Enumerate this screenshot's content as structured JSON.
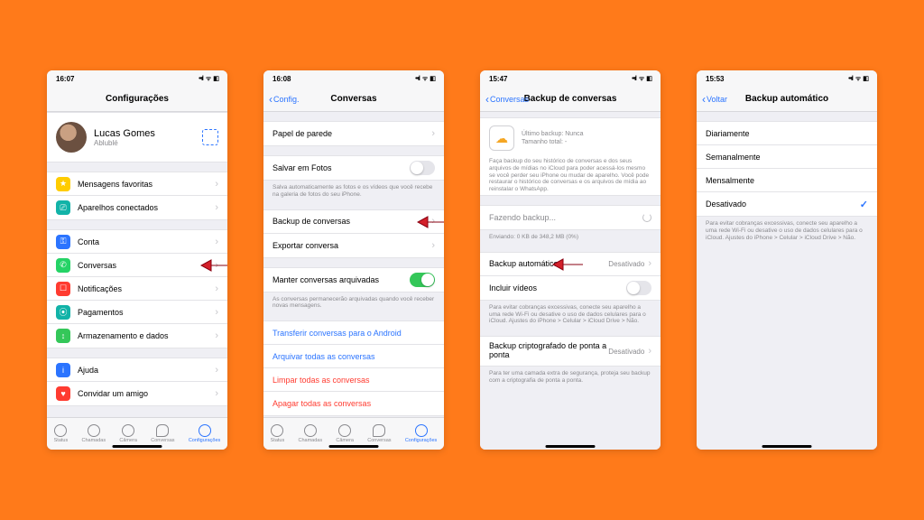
{
  "status": {
    "time1": "16:07",
    "time2": "16:08",
    "time3": "15:47",
    "time4": "15:53"
  },
  "tabs": {
    "status": "Status",
    "calls": "Chamadas",
    "camera": "Câmera",
    "chats": "Conversas",
    "settings": "Configurações"
  },
  "screen1": {
    "title": "Configurações",
    "profile": {
      "name": "Lucas Gomes",
      "status": "Ablublé"
    },
    "starred": "Mensagens favoritas",
    "linked": "Aparelhos conectados",
    "account": "Conta",
    "chats": "Conversas",
    "notif": "Notificações",
    "pay": "Pagamentos",
    "storage": "Armazenamento e dados",
    "help": "Ajuda",
    "invite": "Convidar um amigo"
  },
  "screen2": {
    "back": "Config.",
    "title": "Conversas",
    "wallpaper": "Papel de parede",
    "savePhotos": "Salvar em Fotos",
    "savePhotos_note": "Salva automaticamente as fotos e os vídeos que você recebe na galeria de fotos do seu iPhone.",
    "backup": "Backup de conversas",
    "export": "Exportar conversa",
    "keepArchived": "Manter conversas arquivadas",
    "keepArchived_note": "As conversas permanecerão arquivadas quando você receber novas mensagens.",
    "transfer": "Transferir conversas para o Android",
    "archiveAll": "Arquivar todas as conversas",
    "clearAll": "Limpar todas as conversas",
    "deleteAll": "Apagar todas as conversas"
  },
  "screen3": {
    "back": "Conversas",
    "title": "Backup de conversas",
    "last": "Último backup: Nunca",
    "size": "Tamanho total: -",
    "desc": "Faça backup do seu histórico de conversas e dos seus arquivos de mídias no iCloud para poder acessá-los mesmo se você perder seu iPhone ou mudar de aparelho. Você pode restaurar o histórico de conversas e os arquivos de mídia ao reinstalar o WhatsApp.",
    "doing": "Fazendo backup...",
    "sending": "Enviando: 0 KB de 348,2 MB (0%)",
    "auto": "Backup automático",
    "auto_val": "Desativado",
    "include": "Incluir vídeos",
    "note": "Para evitar cobranças excessivas, conecte seu aparelho a uma rede Wi-Fi ou desative o uso de dados celulares para o iCloud. Ajustes do iPhone > Celular > iCloud Drive > Não.",
    "e2e": "Backup criptografado de ponta a ponta",
    "e2e_val": "Desativado",
    "e2e_note": "Para ter uma camada extra de segurança, proteja seu backup com a criptografia de ponta a ponta."
  },
  "screen4": {
    "back": "Voltar",
    "title": "Backup automático",
    "daily": "Diariamente",
    "weekly": "Semanalmente",
    "monthly": "Mensalmente",
    "off": "Desativado",
    "note": "Para evitar cobranças excessivas, conecte seu aparelho a uma rede Wi-Fi ou desative o uso de dados celulares para o iCloud. Ajustes do iPhone > Celular > iCloud Drive > Não."
  }
}
